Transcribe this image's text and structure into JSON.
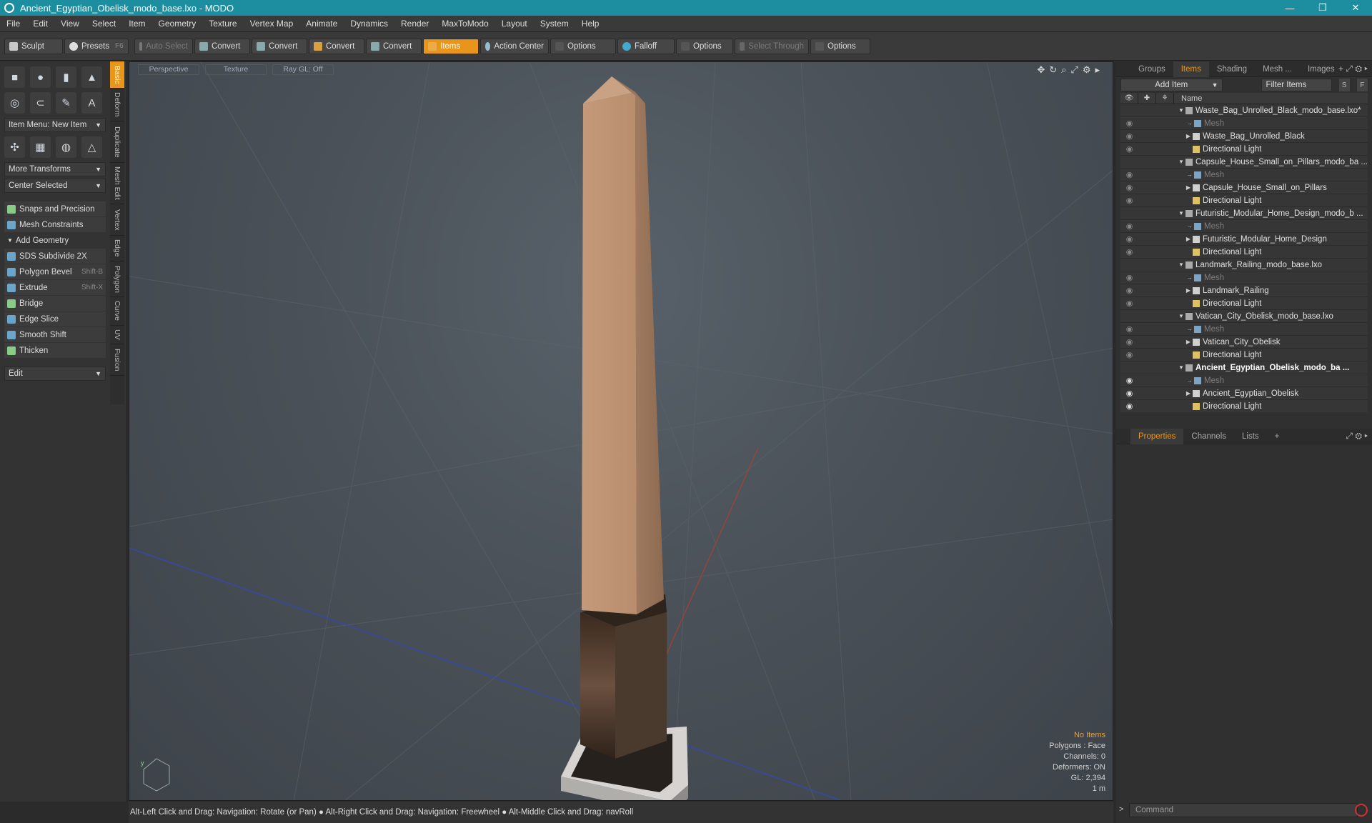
{
  "window": {
    "title": "Ancient_Egyptian_Obelisk_modo_base.lxo - MODO",
    "min": "—",
    "max": "❐",
    "close": "✕"
  },
  "menu": [
    "File",
    "Edit",
    "View",
    "Select",
    "Item",
    "Geometry",
    "Texture",
    "Vertex Map",
    "Animate",
    "Dynamics",
    "Render",
    "MaxToModo",
    "Layout",
    "System",
    "Help"
  ],
  "toolbar": {
    "sculpt": "Sculpt",
    "presets": "Presets",
    "presets_key": "F6",
    "auto_select": "Auto Select",
    "convert": "Convert",
    "items": "Items",
    "action_center": "Action Center",
    "options": "Options",
    "falloff": "Falloff",
    "select_through": "Select Through"
  },
  "left": {
    "item_menu": "Item Menu: New Item",
    "more_transforms": "More Transforms",
    "center_selected": "Center Selected",
    "snaps": "Snaps and Precision",
    "mesh_constraints": "Mesh Constraints",
    "add_geometry": "Add Geometry",
    "tools": [
      {
        "label": "SDS Subdivide 2X",
        "key": ""
      },
      {
        "label": "Polygon Bevel",
        "key": "Shift-B"
      },
      {
        "label": "Extrude",
        "key": "Shift-X"
      },
      {
        "label": "Bridge",
        "key": ""
      },
      {
        "label": "Edge Slice",
        "key": ""
      },
      {
        "label": "Smooth Shift",
        "key": ""
      },
      {
        "label": "Thicken",
        "key": ""
      }
    ],
    "edit": "Edit",
    "vtabs": [
      "Basic",
      "Deform",
      "Duplicate",
      "Mesh Edit",
      "Vertex",
      "Edge",
      "Polygon",
      "Curve",
      "UV",
      "Fusion"
    ]
  },
  "viewport": {
    "perspective": "Perspective",
    "texture": "Texture",
    "raygl": "Ray GL: Off",
    "stats": {
      "no_items": "No Items",
      "polygons": "Polygons : Face",
      "channels": "Channels: 0",
      "deformers": "Deformers: ON",
      "gl": "GL: 2,394",
      "scale": "1 m"
    }
  },
  "status": "Alt-Left Click and Drag: Navigation: Rotate (or Pan) ● Alt-Right Click and Drag: Navigation: Freewheel ● Alt-Middle Click and Drag: navRoll",
  "right": {
    "tabs": [
      "Groups",
      "Items",
      "Shading",
      "Mesh ...",
      "Images"
    ],
    "add_item": "Add Item",
    "filter": "Filter Items",
    "s": "S",
    "f": "F",
    "name_col": "Name",
    "tree": [
      {
        "label": "Waste_Bag_Unrolled_Black_modo_base.lxo*",
        "level": 0,
        "kind": "scene",
        "twisty": "▼"
      },
      {
        "label": "Mesh",
        "level": 2,
        "kind": "mesh",
        "twisty": ""
      },
      {
        "label": "Waste_Bag_Unrolled_Black",
        "level": 1,
        "kind": "item",
        "twisty": "▶"
      },
      {
        "label": "Directional Light",
        "level": 1,
        "kind": "light",
        "twisty": ""
      },
      {
        "label": "Capsule_House_Small_on_Pillars_modo_ba ...",
        "level": 0,
        "kind": "scene",
        "twisty": "▼"
      },
      {
        "label": "Mesh",
        "level": 2,
        "kind": "mesh",
        "twisty": ""
      },
      {
        "label": "Capsule_House_Small_on_Pillars",
        "level": 1,
        "kind": "item",
        "twisty": "▶"
      },
      {
        "label": "Directional Light",
        "level": 1,
        "kind": "light",
        "twisty": ""
      },
      {
        "label": "Futuristic_Modular_Home_Design_modo_b ...",
        "level": 0,
        "kind": "scene",
        "twisty": "▼"
      },
      {
        "label": "Mesh",
        "level": 2,
        "kind": "mesh",
        "twisty": ""
      },
      {
        "label": "Futuristic_Modular_Home_Design",
        "level": 1,
        "kind": "item",
        "twisty": "▶"
      },
      {
        "label": "Directional Light",
        "level": 1,
        "kind": "light",
        "twisty": ""
      },
      {
        "label": "Landmark_Railing_modo_base.lxo",
        "level": 0,
        "kind": "scene",
        "twisty": "▼"
      },
      {
        "label": "Mesh",
        "level": 2,
        "kind": "mesh",
        "twisty": ""
      },
      {
        "label": "Landmark_Railing",
        "level": 1,
        "kind": "item",
        "twisty": "▶"
      },
      {
        "label": "Directional Light",
        "level": 1,
        "kind": "light",
        "twisty": ""
      },
      {
        "label": "Vatican_City_Obelisk_modo_base.lxo",
        "level": 0,
        "kind": "scene",
        "twisty": "▼"
      },
      {
        "label": "Mesh",
        "level": 2,
        "kind": "mesh",
        "twisty": ""
      },
      {
        "label": "Vatican_City_Obelisk",
        "level": 1,
        "kind": "item",
        "twisty": "▶"
      },
      {
        "label": "Directional Light",
        "level": 1,
        "kind": "light",
        "twisty": ""
      },
      {
        "label": "Ancient_Egyptian_Obelisk_modo_ba ...",
        "level": 0,
        "kind": "scene-bold",
        "twisty": "▼"
      },
      {
        "label": "Mesh",
        "level": 2,
        "kind": "mesh",
        "twisty": ""
      },
      {
        "label": "Ancient_Egyptian_Obelisk",
        "level": 1,
        "kind": "item",
        "twisty": "▶"
      },
      {
        "label": "Directional Light",
        "level": 1,
        "kind": "light",
        "twisty": ""
      }
    ],
    "prop_tabs": [
      "Properties",
      "Channels",
      "Lists"
    ],
    "command": "Command"
  },
  "colors": {
    "accent": "#e8961b",
    "titlebar": "#1c8ea0"
  }
}
